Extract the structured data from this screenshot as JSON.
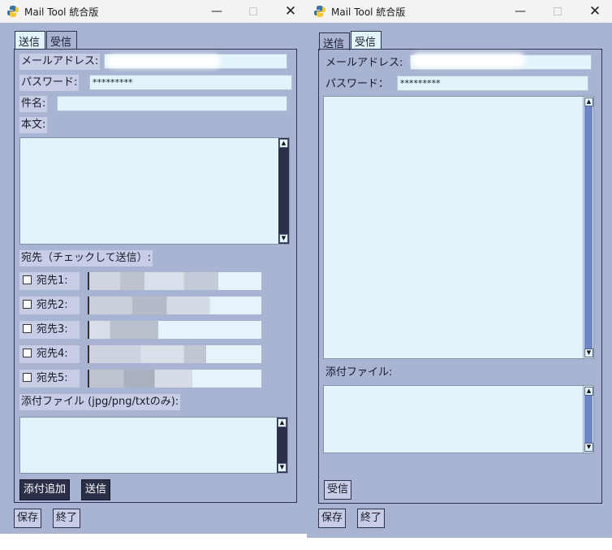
{
  "window_title": "Mail Tool 統合版",
  "controls": {
    "minimize": "—",
    "close": "✕"
  },
  "tabs": {
    "send": "送信",
    "receive": "受信"
  },
  "send_panel": {
    "email_label": "メールアドレス:",
    "password_label": "パスワード:",
    "password_value": "*********",
    "subject_label": "件名:",
    "body_label": "本文:",
    "recipients_label": "宛先（チェックして送信）:",
    "recipients": [
      {
        "label": "宛先1:"
      },
      {
        "label": "宛先2:"
      },
      {
        "label": "宛先3:"
      },
      {
        "label": "宛先4:"
      },
      {
        "label": "宛先5:"
      }
    ],
    "attach_label": "添付ファイル (jpg/png/txtのみ):",
    "add_attach_button": "添付追加",
    "send_button": "送信"
  },
  "receive_panel": {
    "email_label": "メールアドレス:",
    "password_label": "パスワード：",
    "password_value": "*********",
    "attach_label": "添付ファイル:",
    "receive_button": "受信"
  },
  "footer": {
    "save_button": "保存",
    "exit_button": "終了"
  },
  "colors": {
    "window_bg": "#a9b4d3",
    "label_bg": "#c7cde4",
    "entry_bg": "#e2f4fb",
    "dark_button": "#2b3048",
    "scroll_thumb": "#6e86c8"
  }
}
